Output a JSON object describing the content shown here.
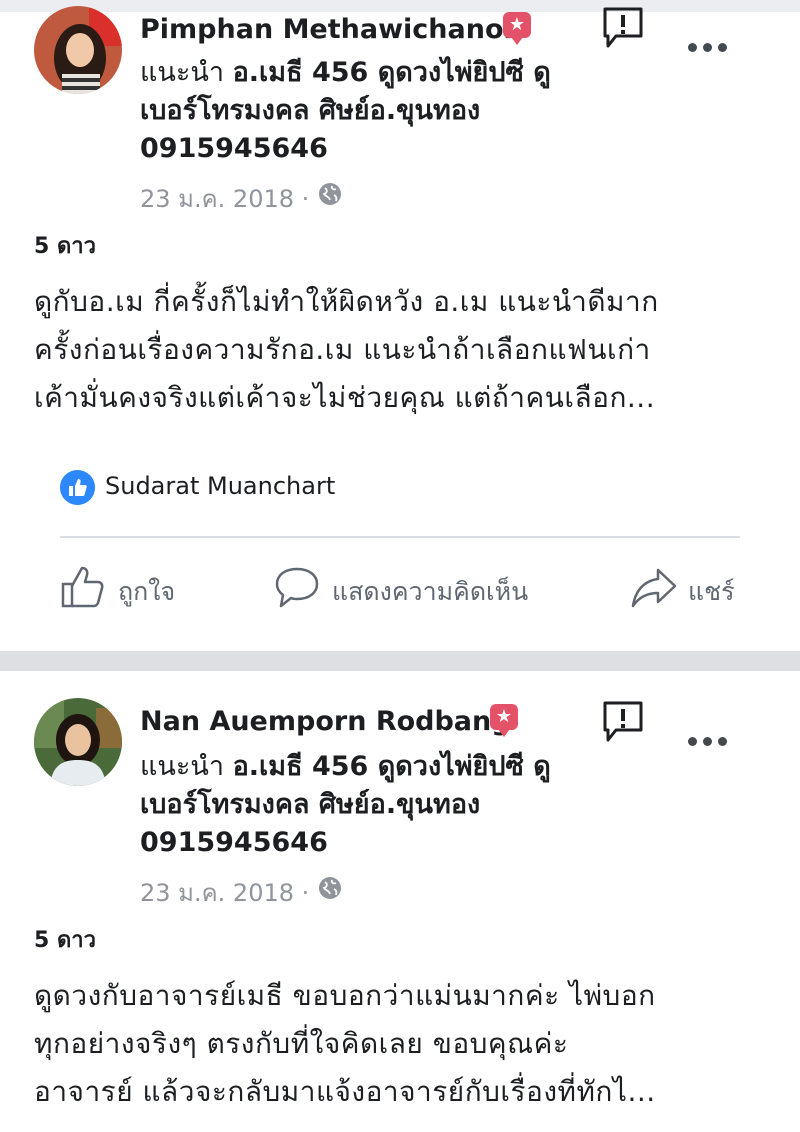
{
  "posts": [
    {
      "author": "Pimphan Methawichanon",
      "rec_prefix": "แนะนำ",
      "rec_line1_bold": "อ.เมธี 456 ดูดวงไพ่ยิปซี ดู",
      "rec_line2": "เบอร์โทรมงคล ศิษย์อ.ขุนทอง",
      "rec_line3": "0915945646",
      "date": "23 ม.ค. 2018 ·",
      "rating": "5 ดาว",
      "body": [
        "ดูกับอ.เม กี่ครั้งก็ไม่ทำให้ผิดหวัง อ.เม แนะนำดีมาก",
        "ครั้งก่อนเรื่องความรักอ.เม แนะนำถ้าเลือกแฟนเก่า",
        "เค้ามั่นคงจริงแต่เค้าจะไม่ช่วยคุณ แต่ถ้าคนเลือก..."
      ],
      "liked_by": "Sudarat Muanchart",
      "actions": {
        "like": "ถูกใจ",
        "comment": "แสดงความคิดเห็น",
        "share": "แชร์"
      }
    },
    {
      "author": "Nan Auemporn Rodbang",
      "rec_prefix": "แนะนำ",
      "rec_line1_bold": "อ.เมธี 456 ดูดวงไพ่ยิปซี ดู",
      "rec_line2": "เบอร์โทรมงคล ศิษย์อ.ขุนทอง",
      "rec_line3": "0915945646",
      "date": "23 ม.ค. 2018 ·",
      "rating": "5 ดาว",
      "body": [
        "ดูดวงกับอาจารย์เมธี ขอบอกว่าแม่นมากค่ะ ไพ่บอก",
        "ทุกอย่างจริงๆ ตรงกับที่ใจคิดเลย ขอบคุณค่ะ",
        "อาจารย์ แล้วจะกลับมาแจ้งอาจารย์กับเรื่องที่ทักไ..."
      ]
    }
  ],
  "icons": {
    "badge": "recommend-badge-icon",
    "report": "report-icon",
    "more": "more-options-icon",
    "audience": "globe-icon",
    "like_reaction": "thumbs-up-reaction-icon",
    "like": "thumbs-up-icon",
    "comment": "comment-bubble-icon",
    "share": "share-arrow-icon"
  },
  "colors": {
    "badge": "#e4526a",
    "like_blue": "#2d88ff",
    "muted": "#90949c",
    "action_gray": "#606770"
  }
}
